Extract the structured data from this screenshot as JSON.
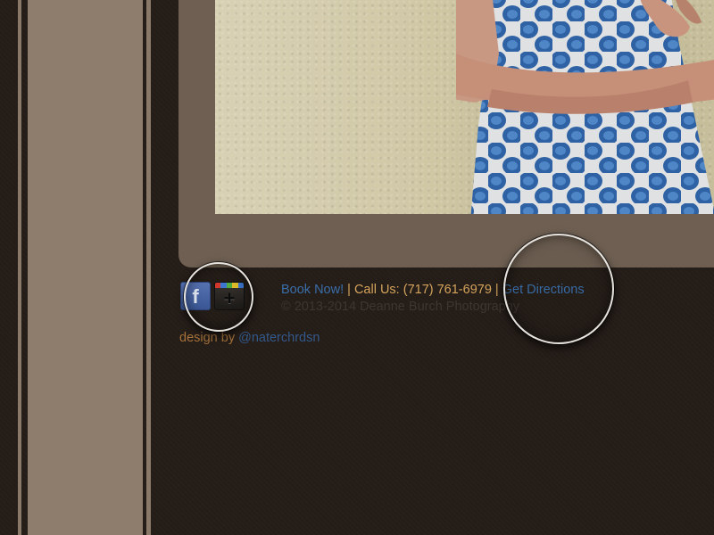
{
  "colors": {
    "background": "#241c17",
    "sidebar": "#8e7d6c",
    "frame": "#6e5f52",
    "link": "#3a6ea8",
    "accent_text": "#d4a35c",
    "muted_text": "#3c3631"
  },
  "social": {
    "facebook_glyph": "f",
    "facebook_icon": "facebook-icon",
    "google_plus_glyph": "+",
    "google_plus_icon": "google-plus-icon",
    "google_plus_stripe_colors": [
      "#d9392f",
      "#3f7ad6",
      "#55b046",
      "#e6c32b",
      "#3f7ad6"
    ]
  },
  "footer": {
    "book_now": "Book Now!",
    "separator_1": " | ",
    "call_us": "Call Us: (717) 761-6979",
    "separator_2": " | ",
    "get_directions": "Get Directions",
    "copyright": "© 2013-2014 Deanne Burch Photography",
    "design_by_prefix": "design by ",
    "designer_handle": "@naterchrdsn"
  }
}
